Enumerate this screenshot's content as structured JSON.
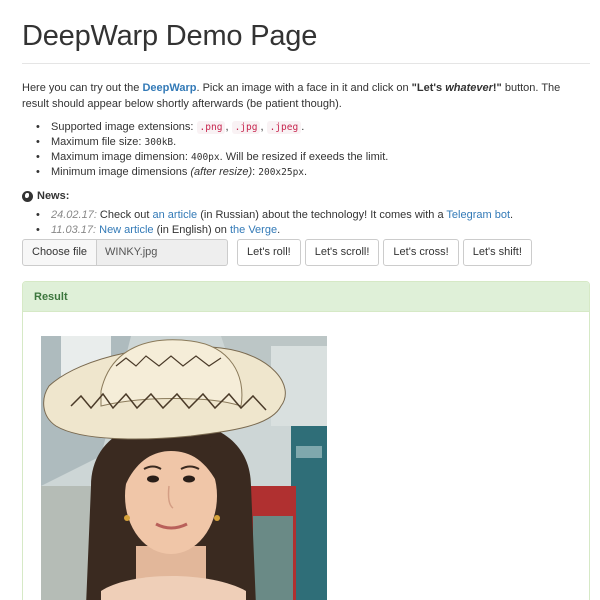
{
  "header": {
    "title": "DeepWarp Demo Page"
  },
  "intro": {
    "part1": "Here you can try out the ",
    "link": "DeepWarp",
    "part2": ". Pick an image with a face in it and click on ",
    "quote_open": "\"Let's ",
    "quote_em": "whatever",
    "quote_close": "!\"",
    "part3": " button. The result should appear below shortly afterwards (be patient though)."
  },
  "requirements": {
    "ext_label": "Supported image extensions: ",
    "ext_values": [
      ".png",
      ".jpg",
      ".jpeg"
    ],
    "ext_sep": ", ",
    "ext_end": ".",
    "size_label": "Maximum file size: ",
    "size_value": "300kB",
    "size_end": ".",
    "dim_label": "Maximum image dimension: ",
    "dim_value": "400px",
    "dim_end": ". Will be resized if exeeds the limit.",
    "min_label": "Minimum image dimensions ",
    "min_em": "(after resize)",
    "min_colon": ": ",
    "min_value": "200x25px",
    "min_end": "."
  },
  "news": {
    "heading": "News:",
    "items": [
      {
        "date": "24.02.17:",
        "t1": " Check out ",
        "link1": "an article",
        "t2": " (in Russian) about the technology! It comes with a ",
        "link2": "Telegram bot",
        "t3": "."
      },
      {
        "date": "11.03.17:",
        "t1": " ",
        "link1": "New article",
        "t2": " (in English) on ",
        "link2": "the Verge",
        "t3": "."
      }
    ]
  },
  "controls": {
    "choose_file": "Choose file",
    "file_name": "WINKY.jpg",
    "buttons": [
      "Let's roll!",
      "Let's scroll!",
      "Let's cross!",
      "Let's shift!"
    ]
  },
  "result": {
    "heading": "Result"
  },
  "colors": {
    "link": "#337ab7",
    "panel_header_bg": "#dff0d8",
    "panel_header_text": "#3c763d",
    "code_text": "#c7254e",
    "code_bg": "#f9f2f4"
  }
}
